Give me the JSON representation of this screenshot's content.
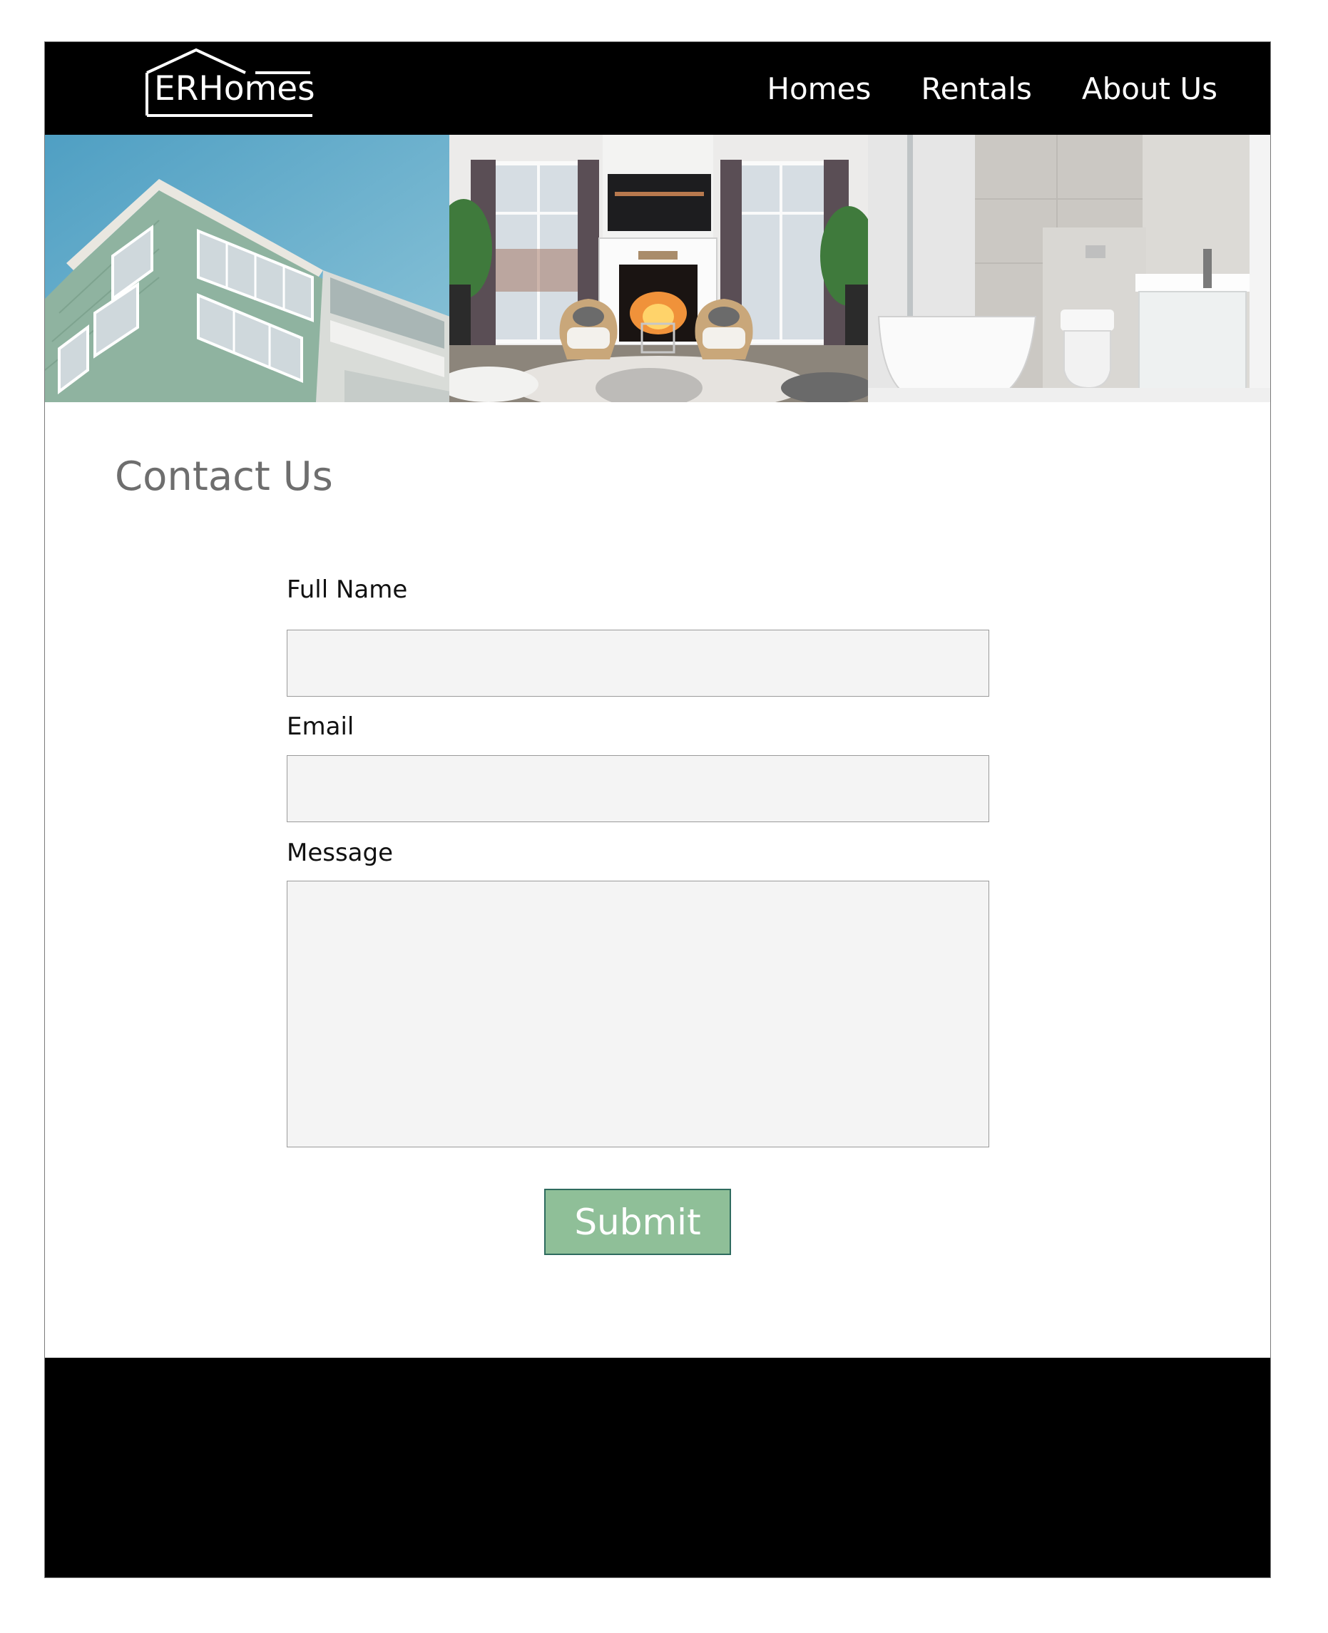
{
  "brand": {
    "name": "ERHomes",
    "accent": "#8fbf98",
    "accent_border": "#2e6b5e"
  },
  "nav": {
    "items": [
      {
        "label": "Homes"
      },
      {
        "label": "Rentals"
      },
      {
        "label": "About Us"
      }
    ]
  },
  "banner": {
    "images": [
      {
        "name": "apartment-building-photo"
      },
      {
        "name": "living-room-fireplace-photo"
      },
      {
        "name": "bathroom-bathtub-photo"
      }
    ]
  },
  "main": {
    "title": "Contact Us"
  },
  "form": {
    "full_name": {
      "label": "Full Name",
      "value": "",
      "placeholder": ""
    },
    "email": {
      "label": "Email",
      "value": "",
      "placeholder": ""
    },
    "message": {
      "label": "Message",
      "value": "",
      "placeholder": ""
    },
    "submit_label": "Submit"
  },
  "colors": {
    "header_bg": "#000000",
    "footer_bg": "#000000",
    "field_bg": "#f4f4f4",
    "title_text": "#6e6e6e"
  }
}
